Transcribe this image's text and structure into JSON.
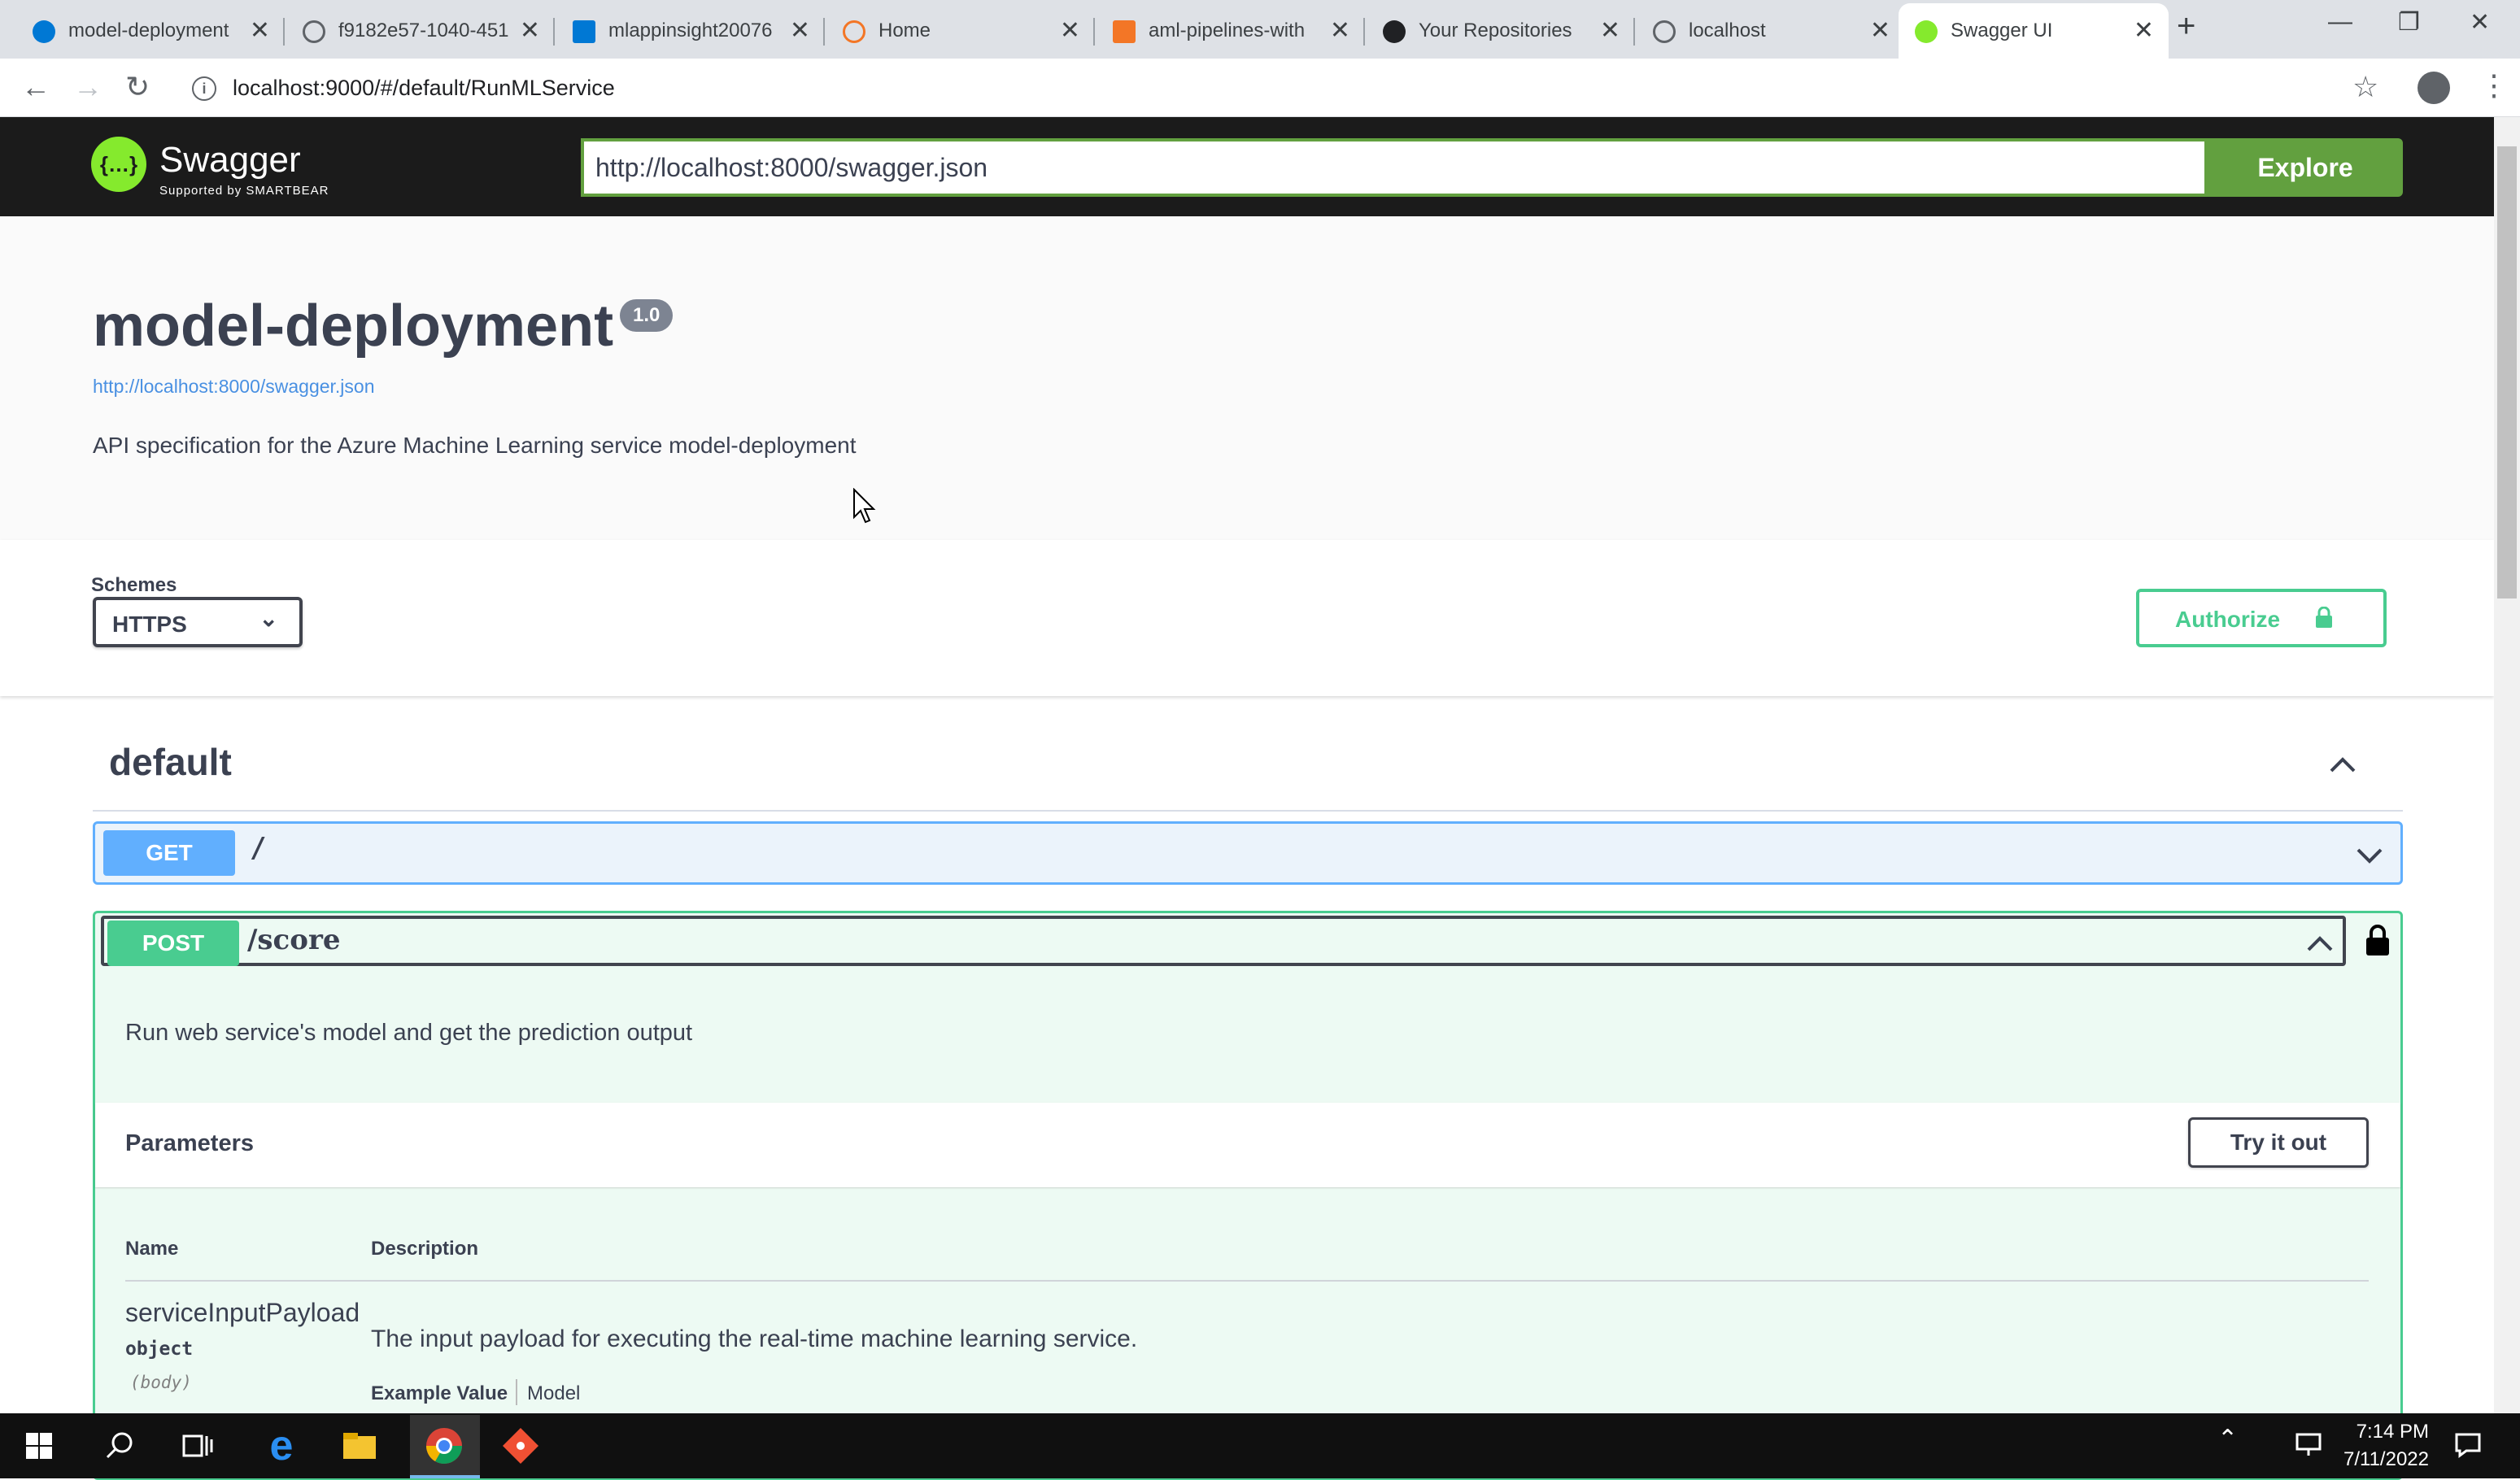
{
  "browser": {
    "tabs": [
      {
        "title": "model-deployment",
        "favicon_color": "#0078d4"
      },
      {
        "title": "f9182e57-1040-451",
        "favicon_color": "#5f6368"
      },
      {
        "title": "mlappinsight20076",
        "favicon_color": "#0078d4"
      },
      {
        "title": "Home",
        "favicon_color": "#f37626"
      },
      {
        "title": "aml-pipelines-with",
        "favicon_color": "#f37626"
      },
      {
        "title": "Your Repositories",
        "favicon_color": "#202124"
      },
      {
        "title": "localhost",
        "favicon_color": "#5f6368"
      },
      {
        "title": "Swagger UI",
        "favicon_color": "#85ea2d",
        "active": true
      }
    ],
    "address": "localhost:9000/#/default/RunMLService"
  },
  "swagger": {
    "logo_text": "Swagger",
    "logo_sub": "Supported by SMARTBEAR",
    "spec_url": "http://localhost:8000/swagger.json",
    "explore_label": "Explore"
  },
  "info": {
    "title": "model-deployment",
    "version": "1.0",
    "link": "http://localhost:8000/swagger.json",
    "description": "API specification for the Azure Machine Learning service model-deployment"
  },
  "schemes": {
    "label": "Schemes",
    "selected": "HTTPS",
    "authorize_label": "Authorize"
  },
  "tag": {
    "name": "default"
  },
  "operations": {
    "get": {
      "method": "GET",
      "path": "/"
    },
    "post": {
      "method": "POST",
      "path": "/score",
      "summary": "Run web service's model and get the prediction output",
      "parameters_title": "Parameters",
      "try_label": "Try it out",
      "columns": {
        "name": "Name",
        "description": "Description"
      },
      "param": {
        "name": "serviceInputPayload",
        "type": "object",
        "in": "(body)",
        "description": "The input payload for executing the real-time machine learning service.",
        "example_value": "Example Value",
        "model": "Model"
      }
    }
  },
  "taskbar": {
    "time": "7:14 PM",
    "date": "7/11/2022"
  },
  "colors": {
    "get": "#61affe",
    "post": "#49cc90",
    "swagger_green": "#62a03f",
    "topbar": "#1b1b1b"
  }
}
